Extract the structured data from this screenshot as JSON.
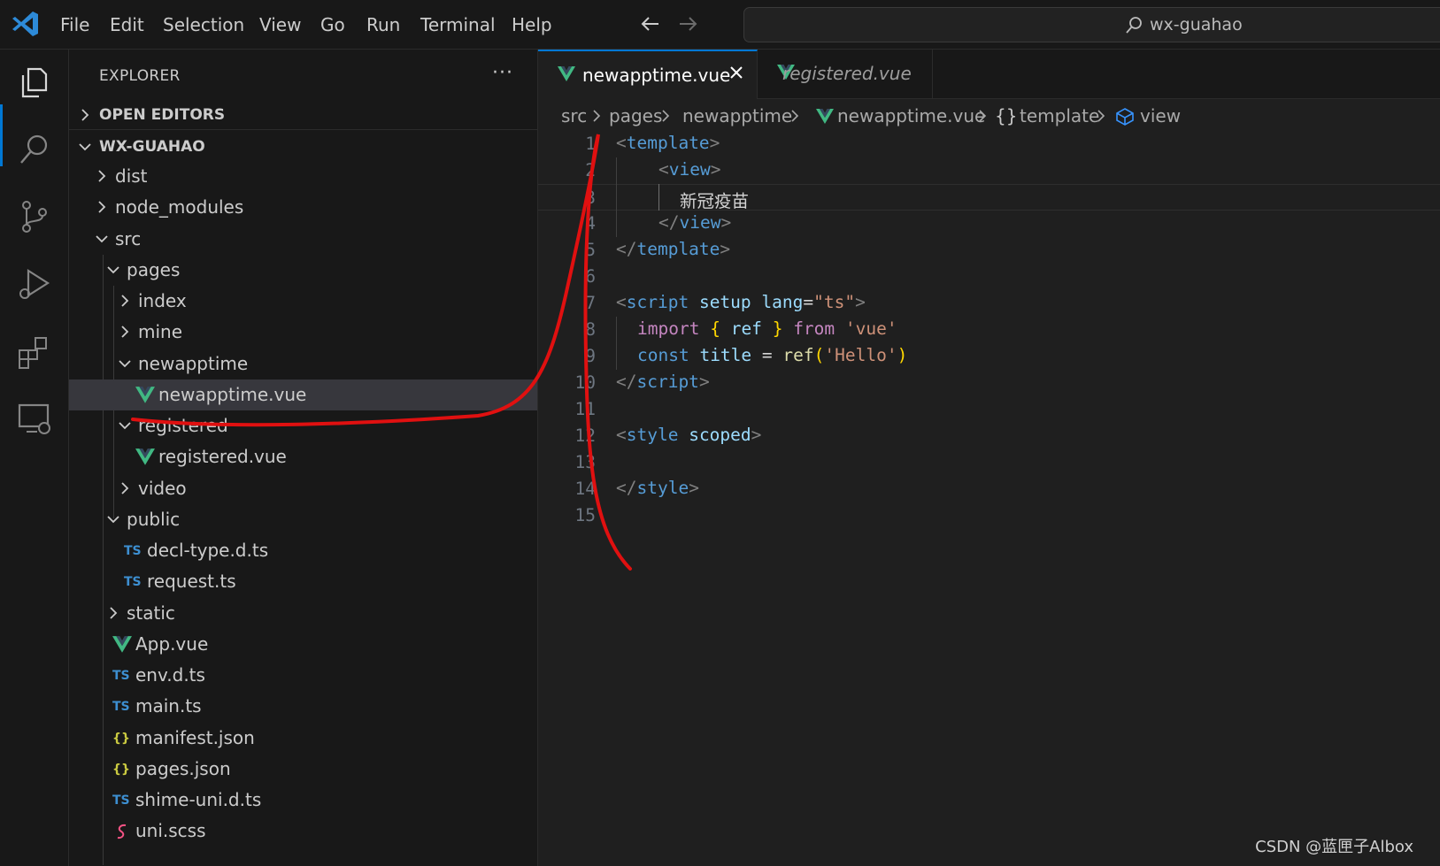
{
  "titlebar": {
    "menu": [
      "File",
      "Edit",
      "Selection",
      "View",
      "Go",
      "Run",
      "Terminal",
      "Help"
    ],
    "command_center": "wx-guahao"
  },
  "activitybar": {
    "icons": [
      "explorer-icon",
      "search-icon",
      "source-control-icon",
      "run-debug-icon",
      "extensions-icon",
      "remote-explorer-icon"
    ]
  },
  "sidebar": {
    "title": "EXPLORER",
    "more": "···",
    "open_editors": "OPEN EDITORS",
    "project": "WX-GUAHAO",
    "tree": [
      {
        "label": "dist",
        "type": "folder",
        "open": false
      },
      {
        "label": "node_modules",
        "type": "folder",
        "open": false
      },
      {
        "label": "src",
        "type": "folder",
        "open": true
      },
      {
        "label": "pages",
        "type": "folder",
        "open": true
      },
      {
        "label": "index",
        "type": "folder",
        "open": false
      },
      {
        "label": "mine",
        "type": "folder",
        "open": false
      },
      {
        "label": "newapptime",
        "type": "folder",
        "open": true
      },
      {
        "label": "newapptime.vue",
        "type": "vue",
        "selected": true
      },
      {
        "label": "registered",
        "type": "folder",
        "open": true
      },
      {
        "label": "registered.vue",
        "type": "vue"
      },
      {
        "label": "video",
        "type": "folder",
        "open": false
      },
      {
        "label": "public",
        "type": "folder",
        "open": true
      },
      {
        "label": "decl-type.d.ts",
        "type": "ts"
      },
      {
        "label": "request.ts",
        "type": "ts"
      },
      {
        "label": "static",
        "type": "folder",
        "open": false
      },
      {
        "label": "App.vue",
        "type": "vue"
      },
      {
        "label": "env.d.ts",
        "type": "ts"
      },
      {
        "label": "main.ts",
        "type": "ts"
      },
      {
        "label": "manifest.json",
        "type": "json"
      },
      {
        "label": "pages.json",
        "type": "json"
      },
      {
        "label": "shime-uni.d.ts",
        "type": "ts"
      },
      {
        "label": "uni.scss",
        "type": "scss"
      }
    ],
    "icon_text": {
      "ts": "TS",
      "json": "{}"
    }
  },
  "editor": {
    "tabs": [
      {
        "label": "newapptime.vue",
        "active": true
      },
      {
        "label": "registered.vue",
        "active": false
      }
    ],
    "breadcrumb": [
      "src",
      "pages",
      "newapptime",
      "newapptime.vue",
      "template",
      "view"
    ],
    "breadcrumb_glyph": "{}",
    "line_numbers": [
      "1",
      "2",
      "3",
      "4",
      "5",
      "6",
      "7",
      "8",
      "9",
      "10",
      "11",
      "12",
      "13",
      "14",
      "15"
    ],
    "code": {
      "l1": {
        "a": "<",
        "b": "template",
        "c": ">"
      },
      "l2": {
        "a": "<",
        "b": "view",
        "c": ">"
      },
      "l3": {
        "text": "新冠疫苗"
      },
      "l4": {
        "a": "</",
        "b": "view",
        "c": ">"
      },
      "l5": {
        "a": "</",
        "b": "template",
        "c": ">"
      },
      "l7": {
        "a": "<",
        "b": "script",
        "attr1": "setup",
        "attr2": "lang",
        "eq": "=",
        "val": "\"ts\"",
        "c": ">"
      },
      "l8": {
        "kw": "import",
        "ob": "{",
        "name": "ref",
        "cb": "}",
        "from": "from",
        "str": "'vue'"
      },
      "l9": {
        "kw": "const",
        "name": "title",
        "eq": "=",
        "fn": "ref",
        "op": "(",
        "str": "'Hello'",
        "cp": ")"
      },
      "l10": {
        "a": "</",
        "b": "script",
        "c": ">"
      },
      "l12": {
        "a": "<",
        "b": "style",
        "attr": "scoped",
        "c": ">"
      },
      "l14": {
        "a": "</",
        "b": "style",
        "c": ">"
      }
    }
  },
  "watermark": "CSDN @蓝匣子Albox",
  "colors": {
    "accent": "#0078d4",
    "vue": "#41b883",
    "annotation": "#e01010"
  }
}
